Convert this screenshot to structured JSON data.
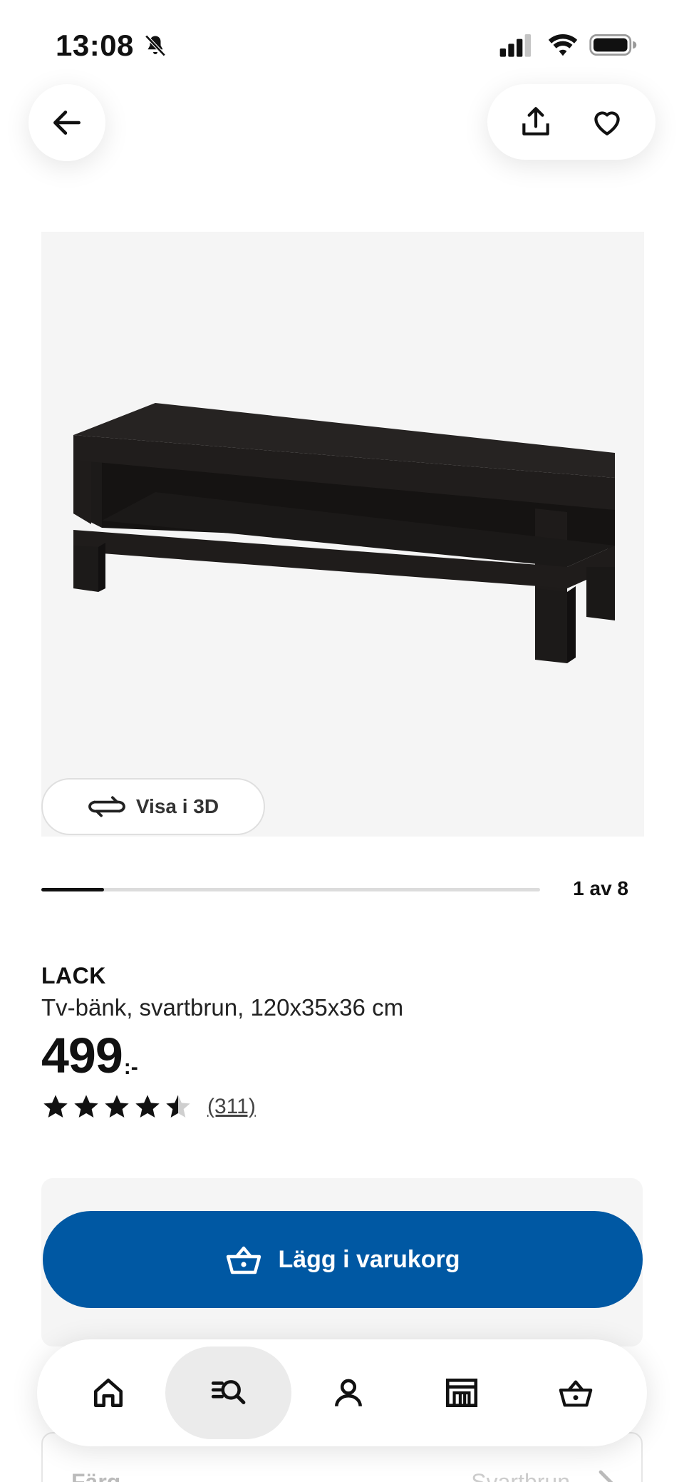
{
  "status_bar": {
    "time": "13:08",
    "icons": [
      "bell-off-icon",
      "signal-icon",
      "wifi-icon",
      "battery-icon"
    ]
  },
  "header": {
    "back_icon": "arrow-left-icon",
    "share_icon": "share-icon",
    "favorite_icon": "heart-icon"
  },
  "gallery": {
    "view_3d_label": "Visa i 3D",
    "view_3d_icon": "rotate-icon",
    "counter": "1 av 8",
    "current": 1,
    "total": 8
  },
  "product": {
    "name": "LACK",
    "description": "Tv-bänk, svartbrun, 120x35x36 cm",
    "price": "499",
    "price_suffix": ":-",
    "rating": 4.5,
    "rating_max": 5,
    "review_count": "(311)"
  },
  "cart": {
    "button_label": "Lägg i varukorg",
    "button_icon": "basket-icon",
    "accent": "#0058a3"
  },
  "color_option": {
    "label": "Färg",
    "value": "Svartbrun"
  },
  "bottom_nav": {
    "items": [
      {
        "icon": "home-icon",
        "active": false
      },
      {
        "icon": "search-icon",
        "active": true
      },
      {
        "icon": "profile-icon",
        "active": false
      },
      {
        "icon": "store-icon",
        "active": false
      },
      {
        "icon": "basket-icon",
        "active": false
      }
    ]
  }
}
